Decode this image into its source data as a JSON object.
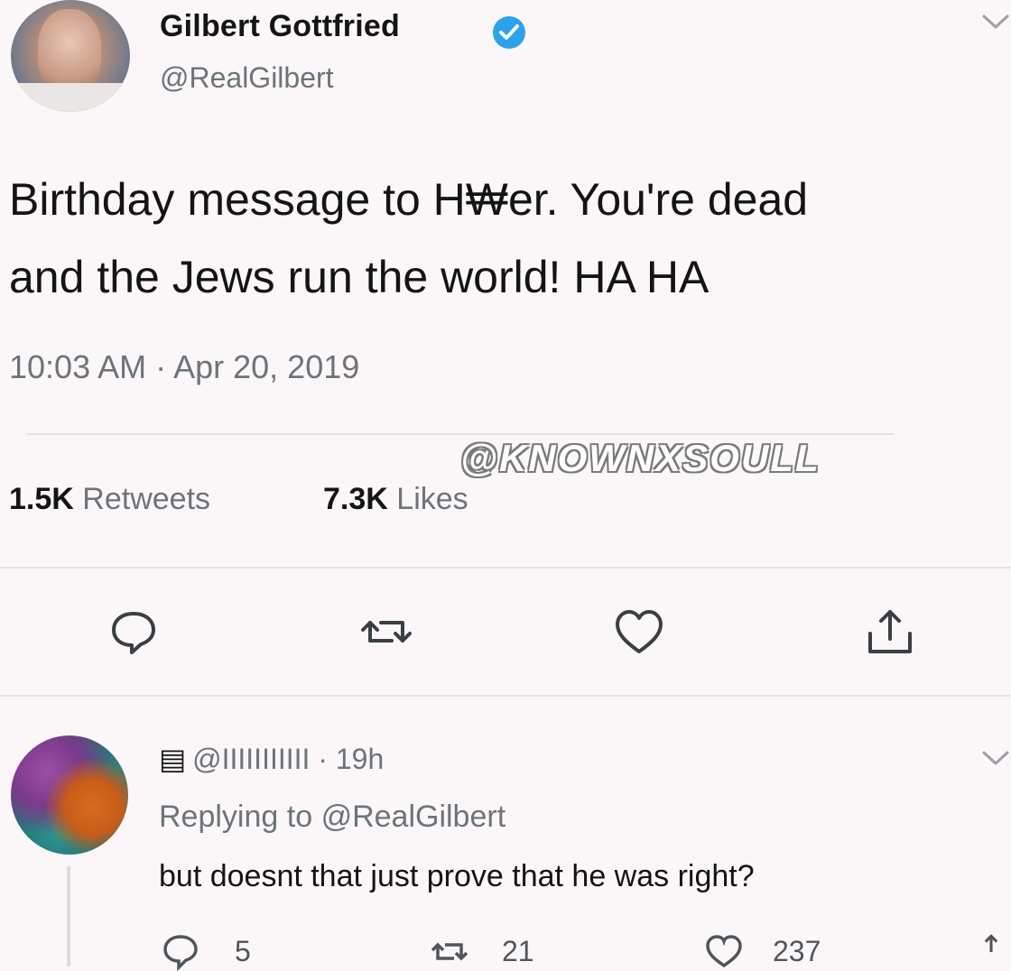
{
  "tweet": {
    "author_name": "Gilbert Gottfried",
    "author_handle": "@RealGilbert",
    "text_line1": "Birthday message to H₩er. You're dead",
    "text_line2": "and the Jews run the world! HA HA",
    "timestamp": "10:03 AM · Apr 20, 2019",
    "retweets_count": "1.5K",
    "retweets_label": "Retweets",
    "likes_count": "7.3K",
    "likes_label": "Likes",
    "watermark": "@KNOWNXSOULL"
  },
  "reply": {
    "handle": "@IIIIIIIIIII",
    "separator": "·",
    "age": "19h",
    "replying_prefix": "Replying to",
    "replying_handle": "@RealGilbert",
    "text": "but doesnt that just prove that he was right?",
    "reply_count": "5",
    "retweet_count": "21",
    "like_count": "237"
  },
  "colors": {
    "verified_badge": "#2aa3ef",
    "text_primary": "#141414",
    "text_secondary": "#6d7479",
    "background": "#fbf7f9"
  },
  "icons": [
    "verified-badge-icon",
    "chevron-down-icon",
    "reply-icon",
    "retweet-icon",
    "like-icon",
    "share-icon"
  ]
}
